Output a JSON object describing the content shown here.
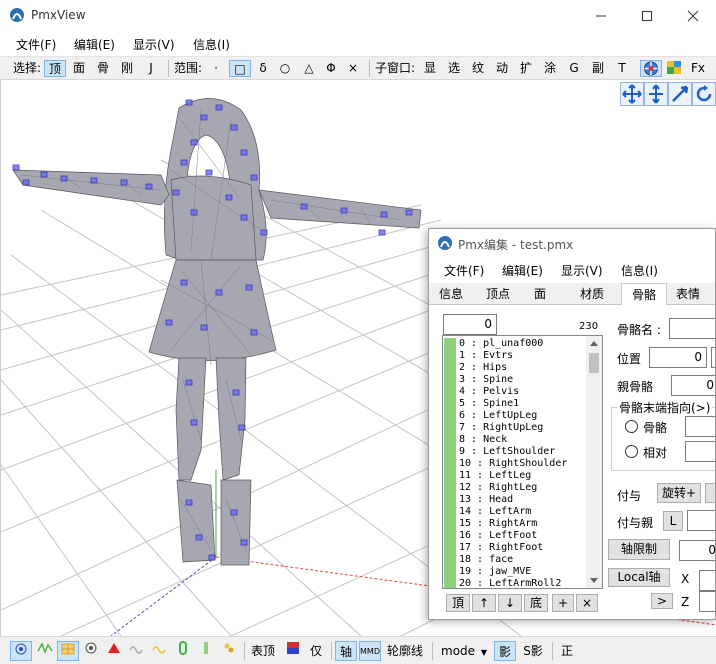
{
  "app": {
    "title": "PmxView"
  },
  "menu": [
    "文件(F)",
    "编辑(E)",
    "显示(V)",
    "信息(I)"
  ],
  "toolbar": {
    "select_label": "选择:",
    "select_items": [
      "顶",
      "面",
      "骨",
      "刚",
      "J"
    ],
    "range_label": "范围:",
    "range_items": [
      "·",
      "□",
      "δ",
      "○",
      "△",
      "Φ",
      "×"
    ],
    "subwin_label": "子窗口:",
    "subwin_items": [
      "显",
      "选",
      "纹",
      "动",
      "扩",
      "涂",
      "G",
      "副",
      "T"
    ],
    "fx_label": "Fx"
  },
  "bottombar": {
    "top_label": "表顶",
    "only_label": "仅",
    "axis_label": "轴",
    "mmd_label": "MMD",
    "outline_label": "轮廓线",
    "mode_label": "mode",
    "shadow_label": "影",
    "sshadow_label": "S影",
    "ortho_label": "正"
  },
  "editor": {
    "title": "Pmx编集 - test.pmx",
    "menu": [
      "文件(F)",
      "编辑(E)",
      "显示(V)",
      "信息(I)"
    ],
    "tabs": [
      "信息",
      "顶点",
      "面",
      "材质",
      "骨骼",
      "表情"
    ],
    "active_tab": "骨骼",
    "index_value": "0",
    "bone_count": "230",
    "bones": [
      "0 : pl_unaf000",
      "1 : Evtrs",
      "2 : Hips",
      "3 : Spine",
      "4 : Pelvis",
      "5 : Spine1",
      "6 : LeftUpLeg",
      "7 : RightUpLeg",
      "8 : Neck",
      "9 : LeftShoulder",
      "10 : RightShoulder",
      "11 : LeftLeg",
      "12 : RightLeg",
      "13 : Head",
      "14 : LeftArm",
      "15 : RightArm",
      "16 : LeftFoot",
      "17 : RightFoot",
      "18 : face",
      "19 : jaw_MVE",
      "20 : LeftArmRoll2"
    ],
    "list_buttons": [
      "頂",
      "↑",
      "↓",
      "底",
      "+",
      "×"
    ],
    "bone_name_label": "骨骼名 :",
    "position_label": "位置",
    "position_value": "0",
    "parent_label": "親骨骼",
    "parent_value": "0",
    "tail_group_label": "骨骼末端指向(>)",
    "tail_bone_label": "骨骼",
    "tail_relative_label": "相对",
    "grant_label": "付与",
    "rotate_button": "旋转+",
    "grant_parent_label": "付与親",
    "grant_parent_button": "L",
    "axis_limit_button": "轴限制",
    "axis_limit_value": "0",
    "local_axis_button": "Local轴",
    "local_x_label": "X",
    "local_z_label": "Z",
    "local_arrow": ">"
  }
}
